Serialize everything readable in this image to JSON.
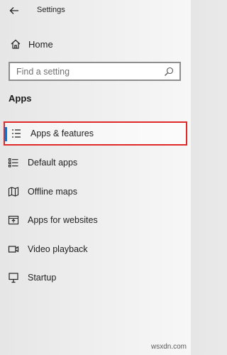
{
  "window": {
    "title": "Settings",
    "back_icon": "back-arrow-icon"
  },
  "home": {
    "label": "Home",
    "icon": "home-icon"
  },
  "search": {
    "placeholder": "Find a setting",
    "value": "",
    "icon": "search-icon"
  },
  "section": {
    "title": "Apps"
  },
  "nav": {
    "items": [
      {
        "label": "Apps & features",
        "icon": "list-icon",
        "selected": true
      },
      {
        "label": "Default apps",
        "icon": "default-apps-icon",
        "selected": false
      },
      {
        "label": "Offline maps",
        "icon": "map-icon",
        "selected": false
      },
      {
        "label": "Apps for websites",
        "icon": "web-app-icon",
        "selected": false
      },
      {
        "label": "Video playback",
        "icon": "video-icon",
        "selected": false
      },
      {
        "label": "Startup",
        "icon": "startup-icon",
        "selected": false
      }
    ]
  },
  "colors": {
    "accent": "#0078d7",
    "highlight_border": "#e02a2a"
  },
  "watermark": "wsxdn.com"
}
